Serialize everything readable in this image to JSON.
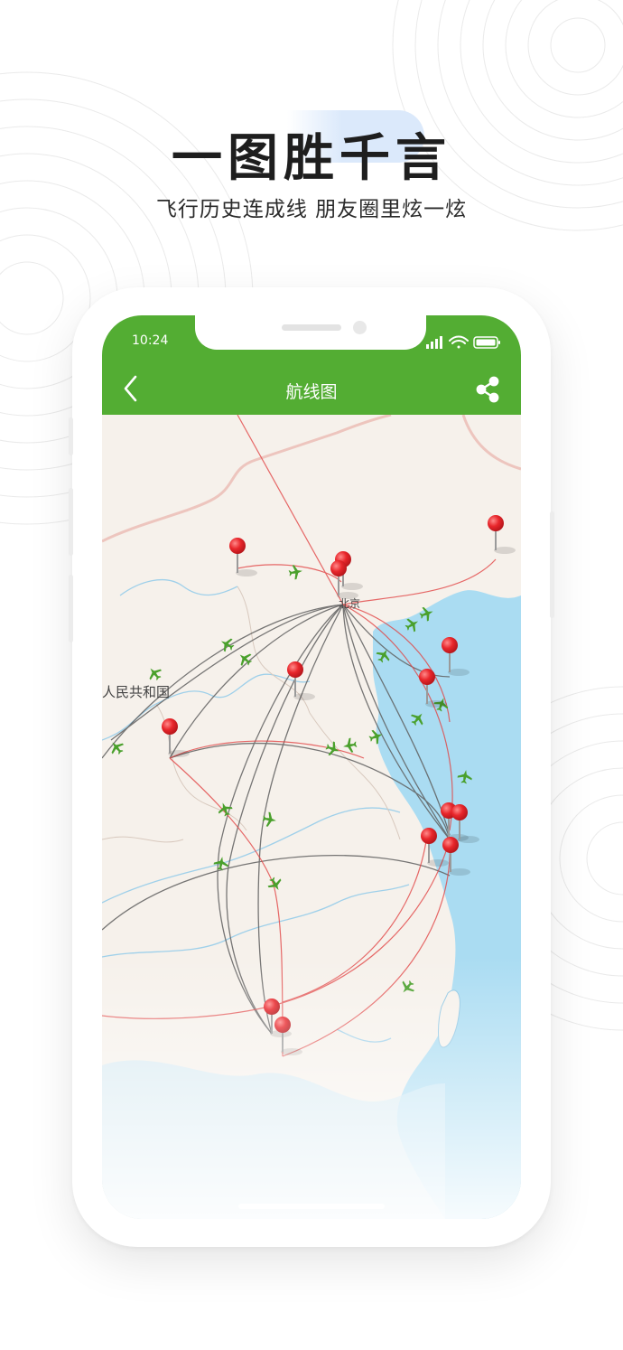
{
  "headline": "一图胜千言",
  "subline": "飞行历史连成线  朋友圈里炫一炫",
  "status_bar": {
    "time": "10:24"
  },
  "app_bar": {
    "title": "航线图"
  },
  "map": {
    "labels": {
      "country": "人民共和国",
      "hub_city": "北京"
    },
    "colors": {
      "route_red": "#e24545",
      "route_gray": "#606060",
      "sea": "#aadcf2",
      "land": "#f6f1eb",
      "plane": "#4aa02c",
      "pin": "#e8262b"
    }
  },
  "colors": {
    "brand_green": "#53ad33"
  }
}
